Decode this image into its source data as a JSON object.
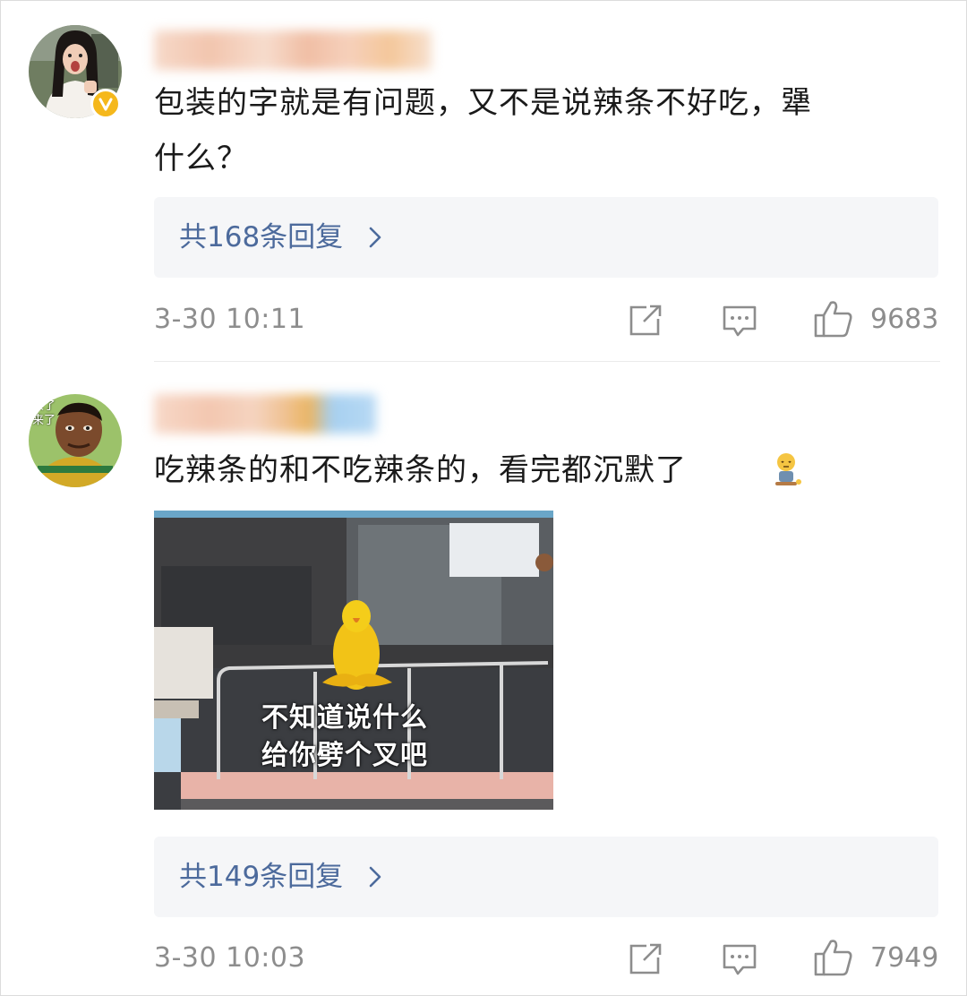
{
  "comments": [
    {
      "text_line1": "包装的字就是有问题，又不是说辣条不好吃，犟",
      "text_line2": "什么？",
      "verified": true,
      "replies_label": "共168条回复",
      "time": "3-30 10:11",
      "likes": "9683"
    },
    {
      "text": "吃辣条的和不吃辣条的，看完都沉默了",
      "meme_caption_line1": "不知道说什么",
      "meme_caption_line2": "给你劈个叉吧",
      "avatar_caption_line1": "来了",
      "avatar_caption_line2": "来了",
      "replies_label": "共149条回复",
      "time": "3-30 10:03",
      "likes": "7949"
    }
  ],
  "icons": {
    "share": "share-icon",
    "comment": "comment-icon",
    "like": "thumbs-up-icon",
    "chevron": "chevron-right-icon",
    "emoji": "silent-person-emoji-icon"
  },
  "colors": {
    "reply_link": "#4c6a9c",
    "meta_text": "#8d8d8d",
    "reply_box": "#f5f6f8",
    "verified_badge": "#f5b81c"
  }
}
